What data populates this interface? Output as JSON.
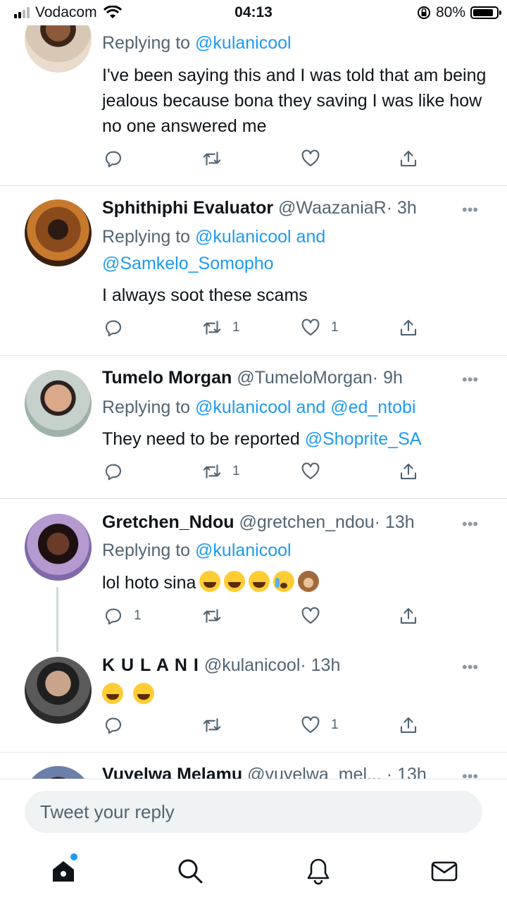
{
  "status_bar": {
    "carrier": "Vodacom",
    "time": "04:13",
    "battery": "80%",
    "battery_level": 0.8
  },
  "tweets": [
    {
      "reply_prefix": "Replying to",
      "reply_to": "@kulanicool",
      "text": "I've been saying this and I was told that am being jealous because bona they saving I was like how no one answered me",
      "counts": {
        "reply": "",
        "retweet": "",
        "like": ""
      }
    },
    {
      "name": "Sphithiphi Evaluator",
      "handle": "@WaazaniaR",
      "time": "· 3h",
      "reply_prefix": "Replying to",
      "reply_to_1": "@kulanicool",
      "reply_and": "and",
      "reply_to_2": "@Samkelo_Somopho",
      "text": "I always soot these scams",
      "counts": {
        "reply": "",
        "retweet": "1",
        "like": "1"
      }
    },
    {
      "name": "Tumelo Morgan",
      "handle": "@TumeloMorgan",
      "time": "· 9h",
      "reply_prefix": "Replying to",
      "reply_to_1": "@kulanicool",
      "reply_and": "and",
      "reply_to_2": "@ed_ntobi",
      "text": "They need to be reported",
      "text_mention": "@Shoprite_SA",
      "counts": {
        "reply": "",
        "retweet": "1",
        "like": ""
      }
    },
    {
      "name": "Gretchen_Ndou",
      "handle": "@gretchen_ndou",
      "time": "· 13h",
      "reply_prefix": "Replying to",
      "reply_to": "@kulanicool",
      "text": "lol hoto sina",
      "emojis": [
        "rolling-on-floor-laughing",
        "rolling-on-floor-laughing",
        "rolling-on-floor-laughing",
        "loudly-crying",
        "monkey"
      ],
      "counts": {
        "reply": "1",
        "retweet": "",
        "like": ""
      }
    },
    {
      "name": "K U L A N I",
      "handle": "@kulanicool",
      "time": "· 13h",
      "emojis": [
        "rolling-on-floor-laughing",
        "rolling-on-floor-laughing"
      ],
      "counts": {
        "reply": "",
        "retweet": "",
        "like": "1"
      }
    },
    {
      "name": "Vuyelwa Melamu",
      "handle": "@vuyelwa_mel...",
      "time": "· 13h"
    }
  ],
  "more_label": "•••",
  "reply_bar": {
    "placeholder": "Tweet your reply"
  },
  "tabbar": {
    "items": [
      {
        "icon": "home-icon",
        "active": true
      },
      {
        "icon": "search-icon"
      },
      {
        "icon": "bell-icon"
      },
      {
        "icon": "mail-icon"
      }
    ]
  }
}
